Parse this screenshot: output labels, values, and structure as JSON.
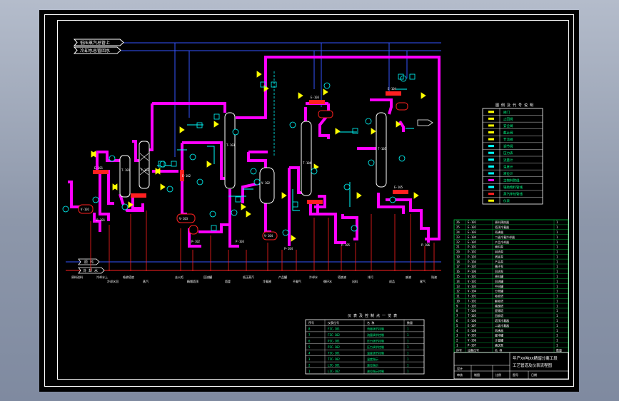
{
  "app": {
    "title": "CAD drawing viewer"
  },
  "colors": {
    "background": "#000000",
    "frame": "#ffffff",
    "main_pipe": "#ff00ff",
    "aux_line": "#00ffff",
    "utility_line": "#3355ff",
    "valve": "#ffff00",
    "vessel": "#ffffff",
    "baseline": "#ff2020",
    "table_grid": "#00cc44"
  },
  "headers": {
    "top_line_1": "低压蒸汽总管上",
    "top_line_2": "冷却水总管回水"
  },
  "bottom_labels": {
    "left_1": "原 料",
    "left_2": "冷 却 水"
  },
  "equipment_tags": [
    "E-101",
    "T-101",
    "T-102",
    "E-102",
    "V-101",
    "T-103",
    "V-102",
    "E-103",
    "T-104",
    "V-103",
    "E-104",
    "T-105",
    "V-104",
    "E-105",
    "P-101",
    "P-102",
    "P-103",
    "P-104",
    "P-105",
    "P-106"
  ],
  "bottom_streams": [
    "原料进料",
    "冷却水上",
    "冷却水回",
    "吸收塔底",
    "蒸汽",
    "去火炬",
    "精馏塔顶",
    "回流罐",
    "塔釜",
    "低压蒸汽",
    "冷凝液",
    "产品罐",
    "不凝气",
    "冷却水",
    "循环水",
    "塔底液",
    "出料",
    "排污",
    "成品",
    "废液",
    "尾气",
    "残液"
  ],
  "legend": {
    "title": "图 例 及 代 号 说 明",
    "items": [
      "阀门",
      "止回阀",
      "安全阀",
      "截止阀",
      "节流阀",
      "调节阀",
      "压力表",
      "流量计",
      "温度计",
      "液位计",
      "主物料管线",
      "辅助物料管线",
      "蒸汽伴热管线",
      "仪表"
    ]
  },
  "instrument_table": {
    "title": "仪 表 及 控 制 点 一 览 表",
    "columns": [
      "序号",
      "仪表位号",
      "名 称",
      "数量"
    ],
    "rows": [
      [
        "8",
        "FIC-101",
        "流量调节控制",
        "1"
      ],
      [
        "7",
        "FIC-102",
        "流量调节控制",
        "1"
      ],
      [
        "6",
        "PIC-101",
        "压力调节控制",
        "1"
      ],
      [
        "5",
        "PIC-102",
        "压力调节控制",
        "1"
      ],
      [
        "4",
        "TIC-101",
        "温度调节控制",
        "1"
      ],
      [
        "3",
        "TIC-102",
        "温度指示",
        "1"
      ],
      [
        "2",
        "LIC-101",
        "液位指示",
        "1"
      ],
      [
        "1",
        "LIC-102",
        "液位指示控制",
        "1"
      ]
    ]
  },
  "equipment_table": {
    "rows": [
      [
        "26",
        "E-101",
        "原料预热器",
        "1"
      ],
      [
        "25",
        "E-102",
        "塔顶冷凝器",
        "1"
      ],
      [
        "24",
        "E-103",
        "再沸器",
        "1"
      ],
      [
        "23",
        "E-104",
        "二级冷凝冷却器",
        "1"
      ],
      [
        "22",
        "E-105",
        "产品冷却器",
        "1"
      ],
      [
        "21",
        "P-101",
        "原料泵",
        "1"
      ],
      [
        "20",
        "P-102",
        "回流泵",
        "1"
      ],
      [
        "19",
        "P-103",
        "塔底泵",
        "1"
      ],
      [
        "18",
        "P-104",
        "产品泵",
        "1"
      ],
      [
        "17",
        "P-105",
        "循环泵",
        "1"
      ],
      [
        "16",
        "P-106",
        "回流泵",
        "1"
      ],
      [
        "15",
        "V-101",
        "原料罐",
        "1"
      ],
      [
        "14",
        "V-102",
        "回流罐",
        "1"
      ],
      [
        "13",
        "V-103",
        "中间罐",
        "1"
      ],
      [
        "12",
        "V-104",
        "分离罐",
        "1"
      ],
      [
        "11",
        "T-101",
        "吸收塔",
        "1"
      ],
      [
        "10",
        "T-102",
        "解吸塔",
        "1"
      ],
      [
        "9",
        "T-103",
        "精馏塔",
        "1"
      ],
      [
        "8",
        "T-104",
        "提馏塔",
        "1"
      ],
      [
        "7",
        "T-105",
        "回收塔",
        "1"
      ],
      [
        "6",
        "E-106",
        "塔顶冷凝器",
        "1"
      ],
      [
        "5",
        "E-107",
        "二级冷凝器",
        "1"
      ],
      [
        "4",
        "E-108",
        "再沸器",
        "1"
      ],
      [
        "3",
        "V-105",
        "缓冲罐",
        "1"
      ],
      [
        "2",
        "V-106",
        "计量罐",
        "1"
      ],
      [
        "1",
        "P-107",
        "输送泵",
        "1"
      ]
    ],
    "footer": [
      "序号",
      "设备位号",
      "名 称",
      "数量"
    ]
  },
  "title_block": {
    "project": "年产XX吨XX精馏分离工段",
    "drawing_name": "工艺管道及仪表流程图",
    "labels": [
      "设计",
      "审核",
      "制图",
      "比例",
      "图号",
      "日期"
    ]
  }
}
